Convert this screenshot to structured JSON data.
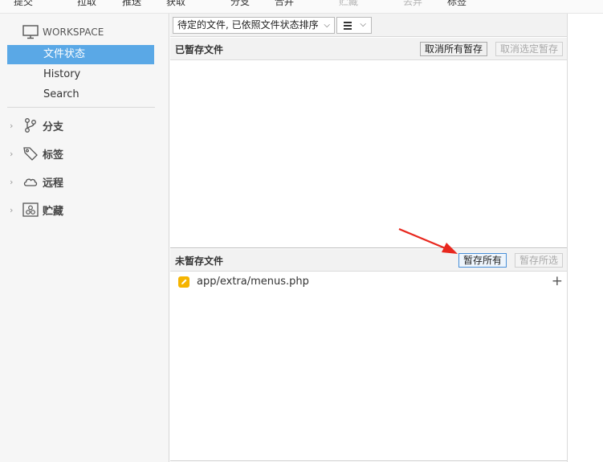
{
  "toolbar": {
    "items": [
      {
        "label": "提交",
        "enabled": true
      },
      {
        "label": "拉取",
        "enabled": true
      },
      {
        "label": "推送",
        "enabled": true
      },
      {
        "label": "获取",
        "enabled": true
      },
      {
        "label": "分支",
        "enabled": true
      },
      {
        "label": "合并",
        "enabled": true
      },
      {
        "label": "贮藏",
        "enabled": false
      },
      {
        "label": "丢弃",
        "enabled": false
      },
      {
        "label": "标签",
        "enabled": true
      }
    ]
  },
  "sidebar": {
    "workspace_label": "WORKSPACE",
    "workspace_items": [
      {
        "label": "文件状态",
        "selected": true
      },
      {
        "label": "History",
        "selected": false
      },
      {
        "label": "Search",
        "selected": false
      }
    ],
    "groups": [
      {
        "label": "分支",
        "icon": "branch-icon"
      },
      {
        "label": "标签",
        "icon": "tag-icon"
      },
      {
        "label": "远程",
        "icon": "cloud-icon"
      },
      {
        "label": "贮藏",
        "icon": "stash-icon"
      }
    ]
  },
  "filter": {
    "sort_select": "待定的文件, 已依照文件状态排序",
    "view_icon": "list-view-icon"
  },
  "staged": {
    "title": "已暂存文件",
    "unstage_all_label": "取消所有暂存",
    "unstage_selected_label": "取消选定暂存"
  },
  "unstaged": {
    "title": "未暂存文件",
    "stage_all_label": "暂存所有",
    "stage_selected_label": "暂存所选",
    "files": [
      {
        "name": "app/extra/menus.php",
        "status": "modified",
        "status_color": "#f5b400"
      }
    ]
  },
  "colors": {
    "selection": "#5aa8e6",
    "annotation_arrow": "#e8271e"
  }
}
